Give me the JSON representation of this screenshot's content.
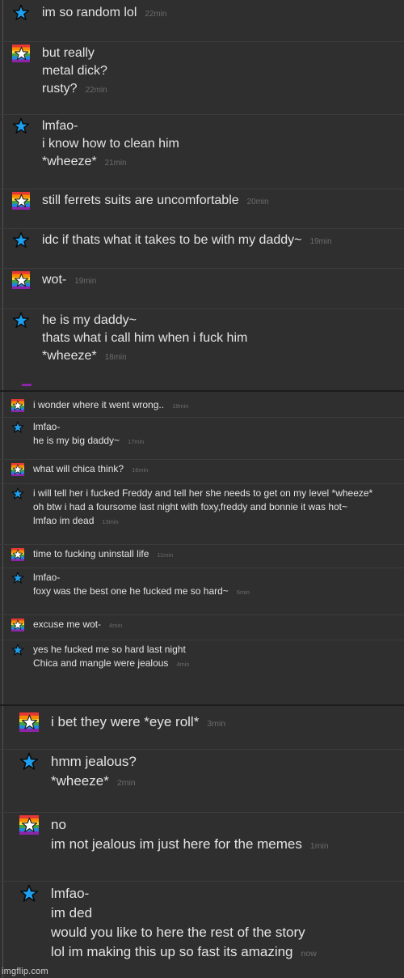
{
  "panels": [
    {
      "messages": [
        {
          "avatar": "blue-star-icon",
          "lines": [
            "im so random lol"
          ],
          "time": "22min"
        },
        {
          "avatar": "rainbow-star-icon",
          "lines": [
            "but really",
            "metal dick?",
            "rusty?"
          ],
          "time": "22min"
        },
        {
          "avatar": "blue-star-icon",
          "lines": [
            "lmfao-",
            "i know how to clean him",
            "*wheeze*"
          ],
          "time": "21min"
        },
        {
          "avatar": "rainbow-star-icon",
          "lines": [
            "still ferrets suits are uncomfortable"
          ],
          "time": "20min"
        },
        {
          "avatar": "blue-star-icon",
          "lines": [
            "idc if thats what it takes to be with my daddy~"
          ],
          "time": "19min"
        },
        {
          "avatar": "rainbow-star-icon",
          "lines": [
            "wot-"
          ],
          "time": "19min"
        },
        {
          "avatar": "blue-star-icon",
          "lines": [
            "he is my daddy~",
            "thats what i call him when i fuck him",
            "*wheeze*"
          ],
          "time": "18min"
        }
      ]
    },
    {
      "messages": [
        {
          "avatar": "rainbow-star-icon",
          "lines": [
            "i wonder where it went wrong.."
          ],
          "time": "18min"
        },
        {
          "avatar": "blue-star-icon",
          "lines": [
            "lmfao-",
            "he is my big daddy~"
          ],
          "time": "17min"
        },
        {
          "avatar": "rainbow-star-icon",
          "lines": [
            "what will chica think?"
          ],
          "time": "16min"
        },
        {
          "avatar": "blue-star-icon",
          "lines": [
            "i will tell her i fucked Freddy and tell her she needs to get on my level *wheeze*",
            "oh btw i had a foursome last night with foxy,freddy and bonnie it was hot~",
            "lmfao im dead"
          ],
          "time": "13min"
        },
        {
          "avatar": "rainbow-star-icon",
          "lines": [
            "time to fucking uninstall life"
          ],
          "time": "11min"
        },
        {
          "avatar": "blue-star-icon",
          "lines": [
            "lmfao-",
            "foxy was the best one he fucked me so hard~"
          ],
          "time": "6min"
        },
        {
          "avatar": "rainbow-star-icon",
          "lines": [
            "excuse me wot-"
          ],
          "time": "4min"
        },
        {
          "avatar": "blue-star-icon",
          "lines": [
            "yes he fucked me so hard last night",
            "Chica and mangle were jealous"
          ],
          "time": "4min"
        }
      ]
    },
    {
      "messages": [
        {
          "avatar": "rainbow-star-icon",
          "lines": [
            "i bet they were *eye roll*"
          ],
          "time": "3min"
        },
        {
          "avatar": "blue-star-icon",
          "lines": [
            "hmm jealous?",
            "*wheeze*"
          ],
          "time": "2min"
        },
        {
          "avatar": "rainbow-star-icon",
          "lines": [
            "no",
            "im not jealous im just here for the memes"
          ],
          "time": "1min"
        },
        {
          "avatar": "blue-star-icon",
          "lines": [
            "lmfao-",
            "im ded",
            "would you like to here the rest of the story",
            "lol im making this up so fast its amazing"
          ],
          "time": "now"
        }
      ]
    }
  ],
  "watermark": "imgflip.com",
  "colors": {
    "background": "#2f2f2f",
    "text": "#e4e4e4",
    "timestamp": "#6c6c6c",
    "blue_star": "#1ea0f0"
  }
}
